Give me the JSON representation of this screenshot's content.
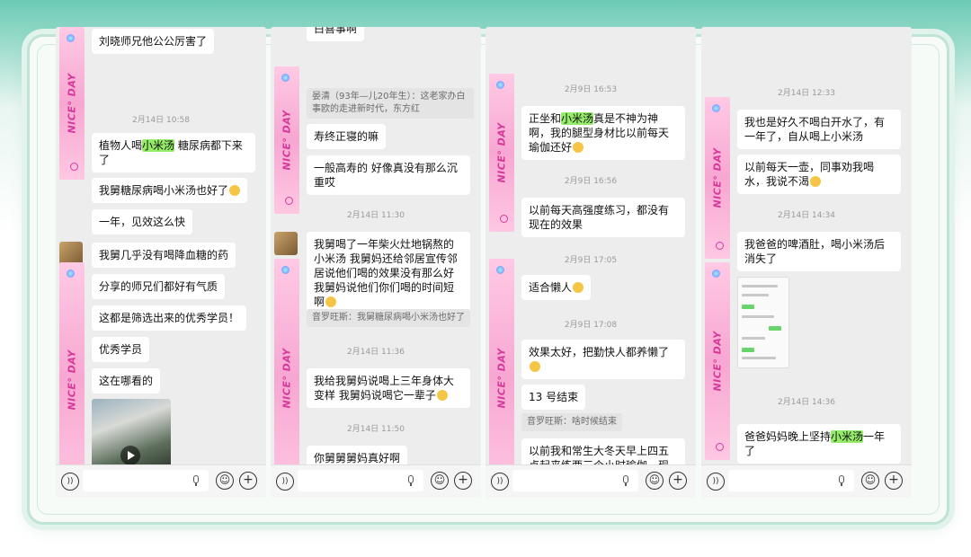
{
  "panels": [
    {
      "messages": [
        {
          "text_before": "刘晓师兄他公公厉害了",
          "hl": "",
          "text_after": ""
        },
        {
          "type": "ts",
          "text": "2月14日 10:58"
        },
        {
          "text_before": "植物人喝",
          "hl": "小米汤",
          "text_after": " 糖尿病都下来了"
        },
        {
          "text_before": "我舅糖尿病喝小米汤也好了",
          "hl": "",
          "text_after": "",
          "emoji": true
        },
        {
          "text_before": "一年，见效这么快",
          "hl": "",
          "text_after": ""
        },
        {
          "text_before": "我舅几乎没有喝降血糖的药",
          "hl": "",
          "text_after": ""
        },
        {
          "text_before": "分享的师兄们都好有气质",
          "hl": "",
          "text_after": ""
        },
        {
          "text_before": "这都是筛选出来的优秀学员！",
          "hl": "",
          "text_after": ""
        },
        {
          "text_before": "优秀学员",
          "hl": "",
          "text_after": ""
        },
        {
          "text_before": "这在哪看的",
          "hl": "",
          "text_after": ""
        }
      ]
    },
    {
      "messages": [
        {
          "text_before": "白喜事啊",
          "hl": "",
          "text_after": ""
        },
        {
          "type": "quote",
          "text": "晏清（93年—儿20年生）：这老家办白事欧的走进新时代，东方红"
        },
        {
          "text_before": "寿终正寝的嘛",
          "hl": "",
          "text_after": ""
        },
        {
          "text_before": "一般高寿的 好像真没有那么沉重哎",
          "hl": "",
          "text_after": ""
        },
        {
          "type": "ts",
          "text": "2月14日 11:30"
        },
        {
          "text_before": "我舅喝了一年柴火灶地锅熬的小米汤 我舅妈还给邻居宣传邻居说他们喝的效果没有那么好 我舅妈说他们你们喝的时间短啊",
          "hl": "",
          "text_after": "",
          "emoji": true
        },
        {
          "type": "quote",
          "text": "音罗旺斯：我舅糖尿病喝小米汤也好了"
        },
        {
          "type": "ts",
          "text": "2月14日 11:36"
        },
        {
          "text_before": "我给我舅妈说喝上三年身体大变样 我舅妈说喝它一辈子",
          "hl": "",
          "text_after": "",
          "emoji": true
        },
        {
          "type": "ts",
          "text": "2月14日 11:50"
        },
        {
          "text_before": "你舅舅舅妈真好啊",
          "hl": "",
          "text_after": ""
        }
      ]
    },
    {
      "messages": [
        {
          "type": "ts",
          "text": "2月9日 16:53"
        },
        {
          "text_before": "正坐和",
          "hl": "小米汤",
          "text_after": "真是不神为神啊，我的腿型身材比以前每天瑜伽还好",
          "emoji": true
        },
        {
          "type": "ts",
          "text": "2月9日 16:56"
        },
        {
          "text_before": "以前每天高强度练习，都没有现在的效果",
          "hl": "",
          "text_after": ""
        },
        {
          "type": "ts",
          "text": "2月9日 17:05"
        },
        {
          "text_before": "适合懒人",
          "hl": "",
          "text_after": "",
          "emoji": true
        },
        {
          "type": "ts",
          "text": "2月9日 17:08"
        },
        {
          "text_before": "效果太好，把勤快人都养懒了",
          "hl": "",
          "text_after": "",
          "emoji": true
        },
        {
          "text_before": "13 号结束",
          "hl": "",
          "text_after": ""
        },
        {
          "type": "quote",
          "text": "音罗旺斯：啥时候结束"
        },
        {
          "text_before": "以前我和常生大冬天早上四五点起来练两三个小时瑜伽，现",
          "hl": "",
          "text_after": ""
        }
      ]
    },
    {
      "messages": [
        {
          "type": "ts",
          "text": "2月14日 12:33"
        },
        {
          "text_before": "我也是好久不喝白开水了，有一年了，自从喝上小米汤",
          "hl": "",
          "text_after": ""
        },
        {
          "text_before": "以前每天一壶，同事劝我喝水，我说不渴",
          "hl": "",
          "text_after": "",
          "emoji": true
        },
        {
          "type": "ts",
          "text": "2月14日 14:34"
        },
        {
          "text_before": "我爸爸的啤酒肚，喝小米汤后消失了",
          "hl": "",
          "text_after": ""
        },
        {
          "type": "ts",
          "text": "2月14日 14:36"
        },
        {
          "text_before": "爸爸妈妈晚上坚持",
          "hl": "小米汤",
          "text_after": "一年了"
        }
      ]
    }
  ],
  "sticker_text": "NICE° DAY",
  "input_bar": {
    "voice_icon": "voice-icon",
    "mic_icon": "mic-icon",
    "emoji_icon": "emoji-icon",
    "plus_icon": "plus-icon"
  },
  "colors": {
    "bubble": "#ffffff",
    "highlight": "#95ec69",
    "chat_bg": "#ededed",
    "sticker": "#f7a7d2",
    "sticker_text": "#d6399b"
  }
}
